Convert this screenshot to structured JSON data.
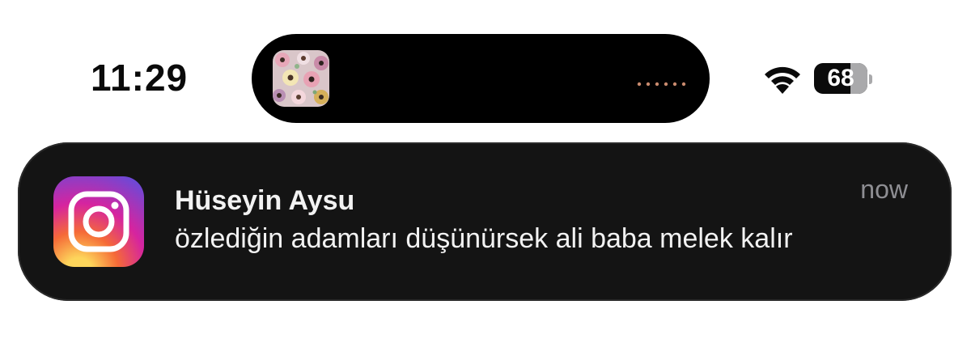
{
  "status_bar": {
    "time": "11:29",
    "battery_level": "68",
    "wifi_icon": "wifi-icon",
    "battery_fill_fraction": 0.68
  },
  "dynamic_island": {
    "album_art_icon": "album-art-thumbnail",
    "waveform_icon": "audio-waveform-icon",
    "waveform_color": "#c98a6e"
  },
  "notification": {
    "app_icon": "instagram-icon",
    "sender": "Hüseyin Aysu",
    "message": "özlediğin adamları düşünürsek ali baba melek kalır",
    "time": "now"
  }
}
